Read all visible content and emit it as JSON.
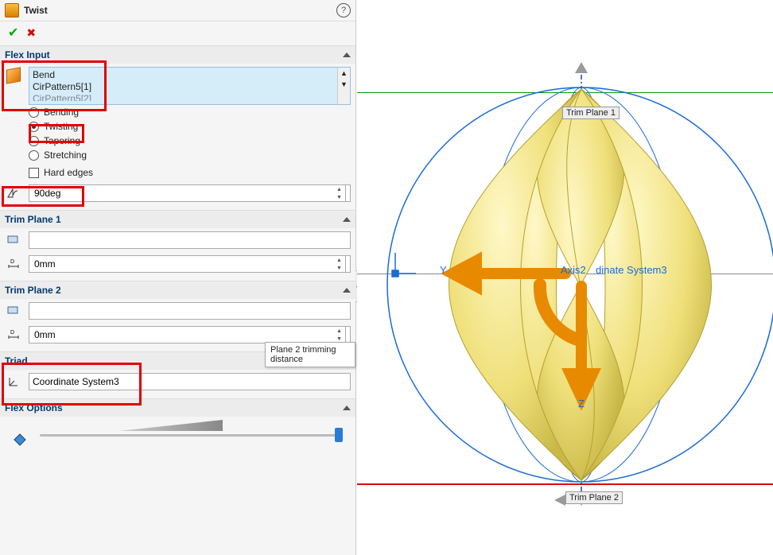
{
  "header": {
    "title": "Twist"
  },
  "flexInput": {
    "title": "Flex Input",
    "items": [
      "Bend",
      "CirPattern5[1]",
      "CirPattern5[2]"
    ],
    "options": {
      "bending": "Bending",
      "twisting": "Twisting",
      "tapering": "Tapering",
      "stretching": "Stretching",
      "hardEdges": "Hard edges"
    },
    "selected": "twisting",
    "angle": "90deg"
  },
  "trim1": {
    "title": "Trim Plane 1",
    "ref": "",
    "dist": "0mm"
  },
  "trim2": {
    "title": "Trim Plane 2",
    "ref": "",
    "dist": "0mm"
  },
  "triad": {
    "title": "Triad",
    "value": "Coordinate System3"
  },
  "flexOptions": {
    "title": "Flex Options"
  },
  "tooltip": "Plane 2 trimming distance",
  "viewport": {
    "topLabel": "Trim Plane 1",
    "bottomLabel": "Trim Plane 2",
    "axisLabel": "Axis2",
    "coordLabel": "dinate System3",
    "yLabel": "Y",
    "zLabel": "Z"
  }
}
